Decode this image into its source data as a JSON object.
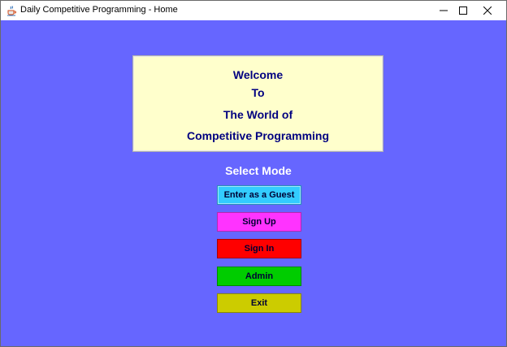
{
  "window": {
    "title": "Daily Competitive Programming - Home"
  },
  "welcome": {
    "line1": "Welcome",
    "line2": "To",
    "line3": "The World of",
    "line4": "Competitive Programming"
  },
  "select_mode_label": "Select Mode",
  "buttons": {
    "guest": "Enter as a Guest",
    "signup": "Sign Up",
    "signin": "Sign In",
    "admin": "Admin",
    "exit": "Exit"
  },
  "colors": {
    "background": "#6666ff",
    "welcome_panel": "#ffffcc",
    "welcome_text": "#000080",
    "guest": "#33ccff",
    "signup": "#ff33ff",
    "signin": "#ff0000",
    "admin": "#00cc00",
    "exit": "#cccc00"
  },
  "icons": {
    "app": "java-cup-icon",
    "minimize": "minimize-icon",
    "maximize": "maximize-icon",
    "close": "close-icon"
  }
}
